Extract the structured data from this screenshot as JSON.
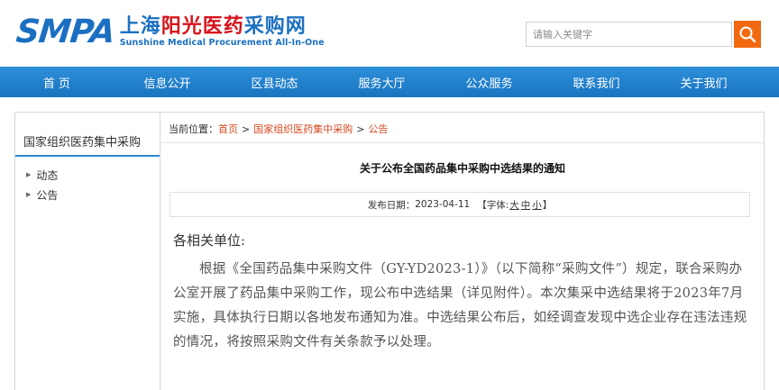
{
  "header": {
    "logo_smpa": "SMPA",
    "logo_cn_part1": "上海",
    "logo_cn_part2": "阳光医药",
    "logo_cn_part3": "采购网",
    "logo_en": "Sunshine Medical Procurement All-In-One",
    "search_placeholder": "请输入关键字",
    "search_icon": "search-icon",
    "search_btn_color": "#f26a10",
    "brand_color": "#1b6fc1"
  },
  "nav": {
    "items": [
      "首 页",
      "信息公开",
      "区县动态",
      "服务大厅",
      "公众服务",
      "联系我们",
      "关于我们"
    ],
    "color": "#1a74c0"
  },
  "sidebar": {
    "title": "国家组织医药集中采购",
    "items": [
      "动态",
      "公告"
    ]
  },
  "breadcrumb": {
    "label": "当前位置：",
    "items": [
      "首页",
      "国家组织医药集中采购",
      "公告"
    ],
    "separator": ">"
  },
  "article": {
    "title": "关于公布全国药品集中采购中选结果的通知",
    "date_label": "发布日期：",
    "date": "2023-04-11",
    "font_label": "【字体:",
    "font_large": "大",
    "font_medium": "中",
    "font_small": "小",
    "font_close": "】",
    "salutation": "各相关单位:",
    "body": "根据《全国药品集中采购文件（GY-YD2023-1）》（以下简称“采购文件”）规定，联合采购办公室开展了药品集中采购工作，现公布中选结果（详见附件）。本次集采中选结果将于2023年7月实施，具体执行日期以各地发布通知为准。中选结果公布后，如经调查发现中选企业存在违法违规的情况，将按照采购文件有关条款予以处理。"
  }
}
